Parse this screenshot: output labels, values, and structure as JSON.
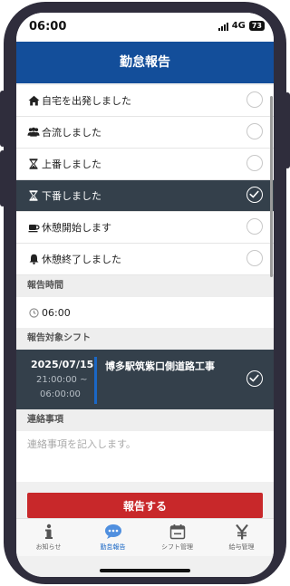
{
  "status_bar": {
    "time": "06:00",
    "network": "4G",
    "battery": "73"
  },
  "header": {
    "title": "勤怠報告"
  },
  "report_options": [
    {
      "icon": "home-icon",
      "label": "自宅を出発しました",
      "selected": false
    },
    {
      "icon": "group-icon",
      "label": "合流しました",
      "selected": false
    },
    {
      "icon": "hourglass-icon",
      "label": "上番しました",
      "selected": false
    },
    {
      "icon": "hourglass-icon",
      "label": "下番しました",
      "selected": true
    },
    {
      "icon": "coffee-icon",
      "label": "休憩開始します",
      "selected": false
    },
    {
      "icon": "bell-icon",
      "label": "休憩終了しました",
      "selected": false
    }
  ],
  "report_time": {
    "label": "報告時間",
    "value": "06:00"
  },
  "shift_section": {
    "label": "報告対象シフト",
    "shift": {
      "date": "2025/07/15",
      "start": "21:00:00 ~",
      "end": "06:00:00",
      "site": "博多駅筑紫口側道路工事",
      "selected": true
    }
  },
  "memo": {
    "label": "連絡事項",
    "placeholder": "連絡事項を記入します。"
  },
  "submit_button": {
    "label": "報告する"
  },
  "tabs": [
    {
      "icon": "info-icon",
      "label": "お知らせ",
      "active": false
    },
    {
      "icon": "chat-icon",
      "label": "勤怠報告",
      "active": true
    },
    {
      "icon": "calendar-icon",
      "label": "シフト管理",
      "active": false
    },
    {
      "icon": "yen-icon",
      "label": "給与管理",
      "active": false
    }
  ],
  "colors": {
    "header": "#134e9a",
    "selected_row": "#34404b",
    "submit": "#c8282a",
    "accent": "#1a67c5"
  }
}
